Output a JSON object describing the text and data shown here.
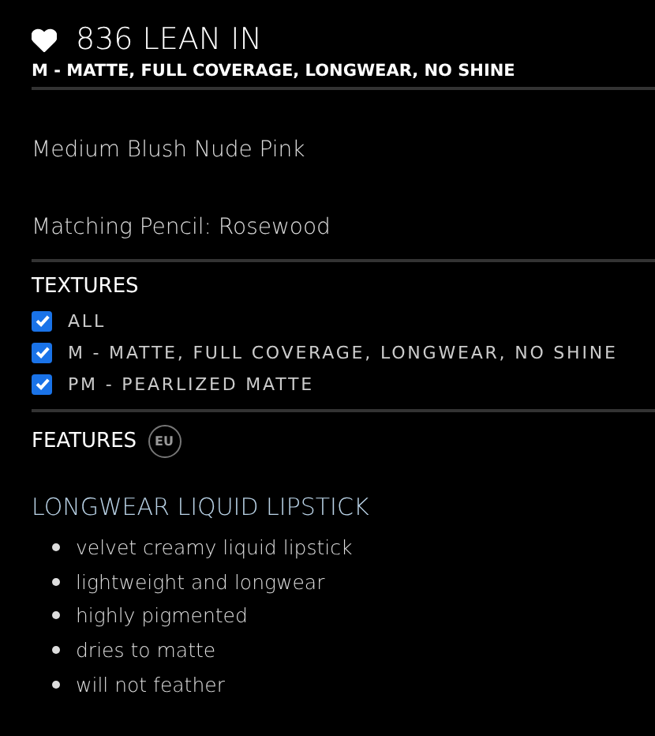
{
  "product": {
    "favorite": true,
    "name": "836 LEAN IN",
    "texture": "M - MATTE, FULL COVERAGE, LONGWEAR, NO SHINE"
  },
  "details": [
    "Medium Blush Nude Pink",
    "Matching Pencil: Rosewood"
  ],
  "textures": {
    "title": "TEXTURES",
    "options": [
      {
        "label": "ALL",
        "checked": true
      },
      {
        "label": "M - MATTE, FULL COVERAGE, LONGWEAR, NO SHINE",
        "checked": true
      },
      {
        "label": "PM - PEARLIZED MATTE",
        "checked": true
      }
    ]
  },
  "features": {
    "title": "FEATURES",
    "badge": "EU"
  },
  "description": {
    "title": "LONGWEAR LIQUID LIPSTICK",
    "bullets": [
      "velvet creamy liquid lipstick",
      "lightweight and longwear",
      "highly pigmented",
      "dries to matte",
      "will not feather"
    ]
  }
}
